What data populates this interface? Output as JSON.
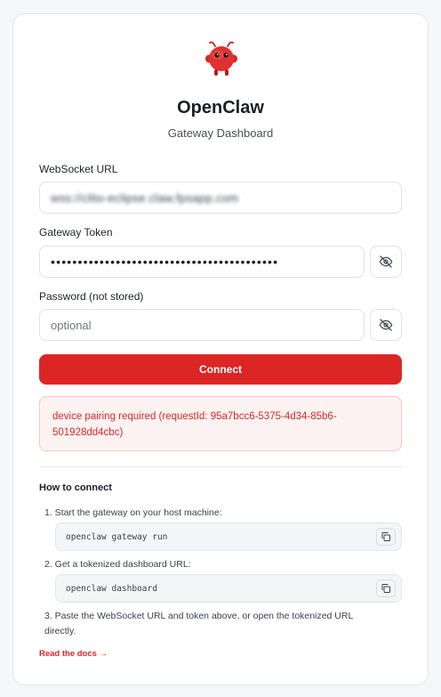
{
  "brand": {
    "title": "OpenClaw",
    "subtitle": "Gateway Dashboard",
    "accent_color": "#dc2626",
    "logo_icon": "red-crab-mascot-icon"
  },
  "form": {
    "websocket_label": "WebSocket URL",
    "websocket_value": "wss://clito-eclipse.claw.fpsapp.com",
    "token_label": "Gateway Token",
    "token_value": "••••••••••••••••••••••••••••••••••••••••••",
    "password_label": "Password (not stored)",
    "password_placeholder": "optional",
    "toggle_icon": "eye-off-icon",
    "connect_label": "Connect"
  },
  "error": {
    "message": "device pairing required (requestId: 95a7bcc6-5375-4d34-85b6-501928dd4cbc)"
  },
  "howto": {
    "title": "How to connect",
    "steps": [
      {
        "text": "1. Start the gateway on your host machine:",
        "command": "openclaw gateway run"
      },
      {
        "text": "2. Get a tokenized dashboard URL:",
        "command": "openclaw dashboard"
      },
      {
        "text": "3. Paste the WebSocket URL and token above, or open the tokenized URL directly."
      }
    ],
    "copy_icon": "copy-icon",
    "docs_link": "Read the docs →"
  }
}
